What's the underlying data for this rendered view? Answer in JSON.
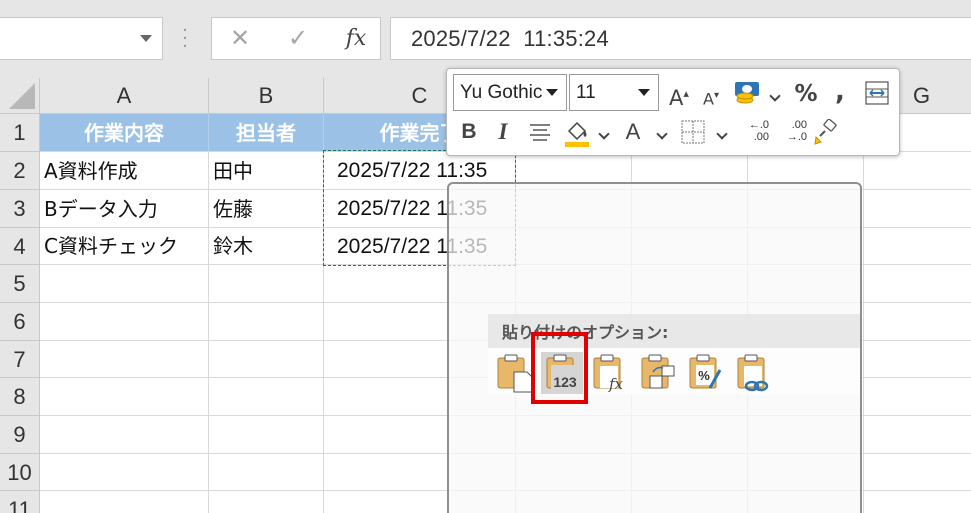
{
  "formula_bar": {
    "name_box": "",
    "cancel_icon": "✕",
    "enter_icon": "✓",
    "fx_label": "fx",
    "value": "2025/7/22  11:35:24"
  },
  "columns": [
    "A",
    "B",
    "C",
    "G"
  ],
  "rows": [
    "1",
    "2",
    "3",
    "4",
    "5",
    "6",
    "7",
    "8",
    "9",
    "10",
    "11"
  ],
  "table": {
    "headers": [
      "作業内容",
      "担当者",
      "作業完了"
    ],
    "data": [
      [
        "A資料作成",
        "田中",
        "2025/7/22",
        "11:35"
      ],
      [
        "Bデータ入力",
        "佐藤",
        "2025/7/22",
        "11:35"
      ],
      [
        "C資料チェック",
        "鈴木",
        "2025/7/22",
        "11:35"
      ]
    ]
  },
  "mini_toolbar": {
    "font_name": "Yu Gothic",
    "font_size": "11",
    "grow_font": "A",
    "shrink_font": "A",
    "percent": "%",
    "comma": ",",
    "bold": "B",
    "italic": "I",
    "font_color": "A",
    "inc_decimal_top": "←.0",
    "inc_decimal_bottom": ".00",
    "dec_decimal_top": ".00",
    "dec_decimal_bottom": "→.0",
    "accent_fill": "#ffc000",
    "accent_blue": "#2e75b6"
  },
  "paste_menu": {
    "title": "貼り付けのオプション:",
    "values_label": "123",
    "highlight_color": "#e00000"
  }
}
